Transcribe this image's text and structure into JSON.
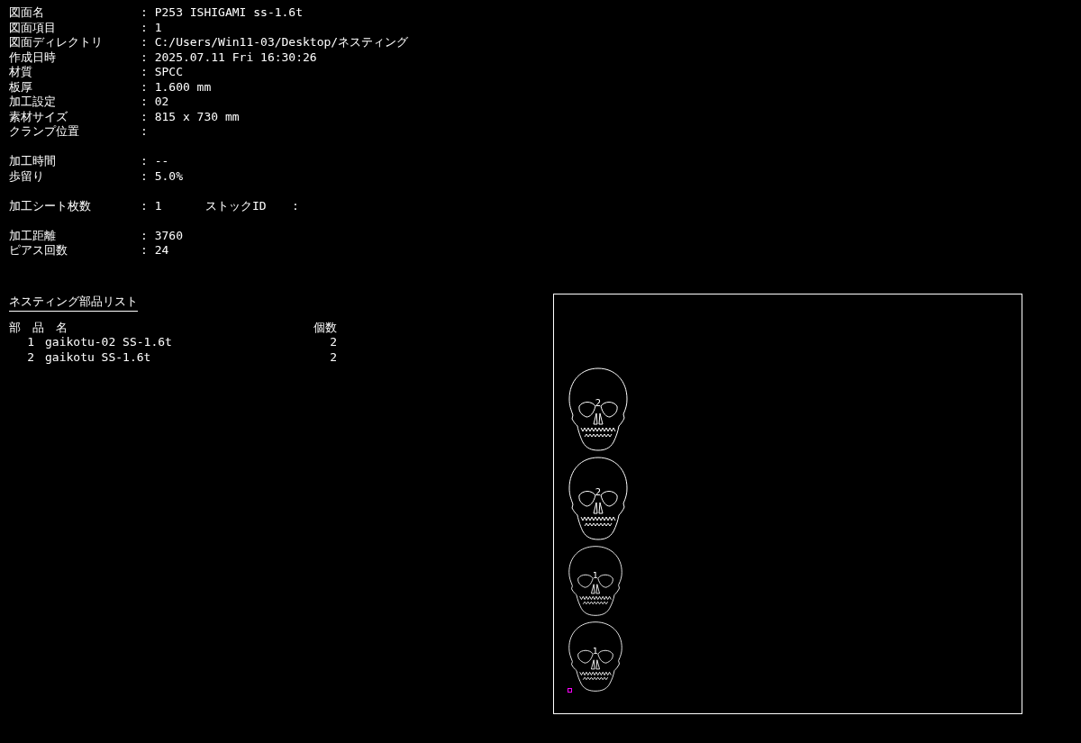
{
  "info_groups": [
    [
      {
        "label": "図面名",
        "value": ": P253 ISHIGAMI ss-1.6t"
      },
      {
        "label": "図面項目",
        "value": ": 1"
      },
      {
        "label": "図面ディレクトリ",
        "value": ": C:/Users/Win11-03/Desktop/ネスティング"
      },
      {
        "label": "作成日時",
        "value": ": 2025.07.11 Fri 16:30:26"
      },
      {
        "label": "材質",
        "value": ": SPCC"
      },
      {
        "label": "板厚",
        "value": ": 1.600 mm"
      },
      {
        "label": "加工設定",
        "value": ": 02"
      },
      {
        "label": "素材サイズ",
        "value": ": 815 x 730 mm"
      },
      {
        "label": "クランプ位置",
        "value": ":"
      }
    ],
    [
      {
        "label": "加工時間",
        "value": ": --"
      },
      {
        "label": "歩留り",
        "value": ": 5.0%"
      }
    ],
    [
      {
        "label": "加工シート枚数",
        "value": ": 1",
        "extra_label": "ストックID",
        "extra_value": ":"
      }
    ],
    [
      {
        "label": "加工距離",
        "value": ": 3760"
      },
      {
        "label": "ピアス回数",
        "value": ": 24"
      }
    ]
  ],
  "parts_list": {
    "title": "ネスティング部品リスト",
    "name_header": "部　品　名",
    "count_header": "個数",
    "rows": [
      {
        "no": "1",
        "name": "gaikotu-02 SS-1.6t",
        "count": "2"
      },
      {
        "no": "2",
        "name": "gaikotu SS-1.6t",
        "count": "2"
      }
    ]
  },
  "sheet": {
    "parts": [
      {
        "label": "2",
        "kind": "large"
      },
      {
        "label": "2",
        "kind": "large"
      },
      {
        "label": "1",
        "kind": "small"
      },
      {
        "label": "1",
        "kind": "small"
      }
    ]
  }
}
